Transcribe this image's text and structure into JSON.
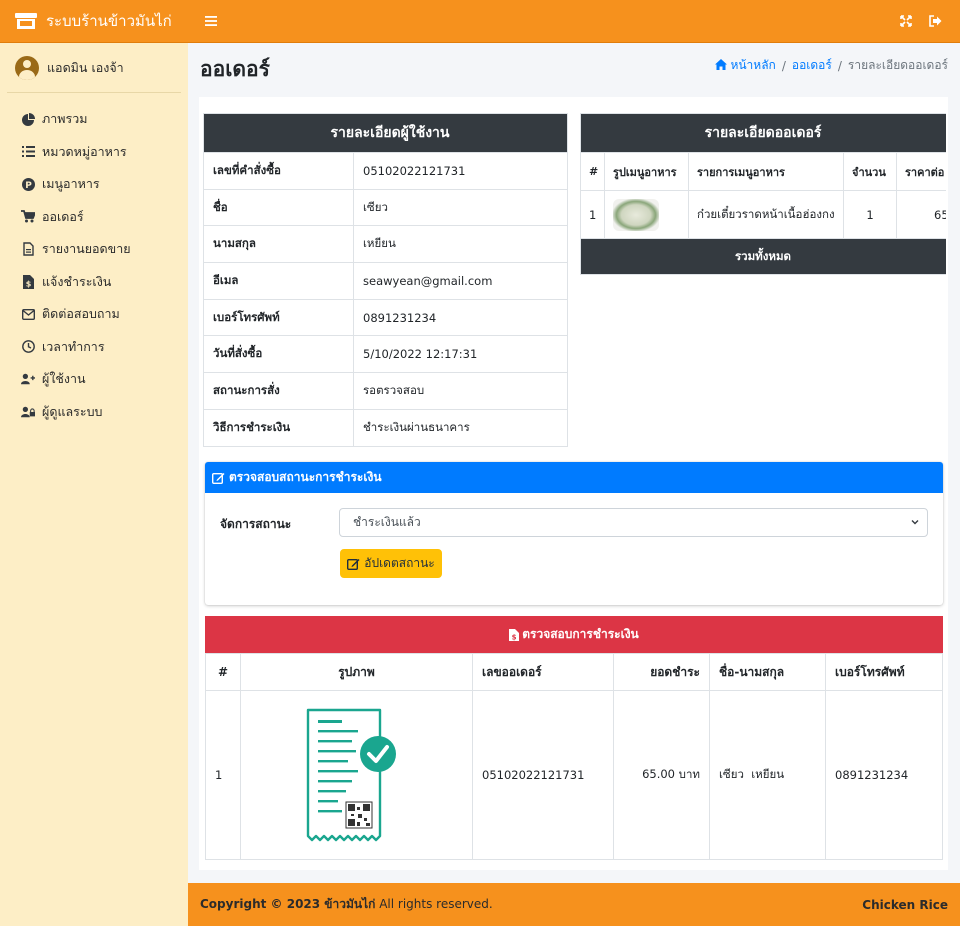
{
  "app": {
    "title": "ระบบร้านข้าวมันไก่"
  },
  "user": {
    "name": "แอดมิน เองจ้า"
  },
  "sidebar": {
    "items": [
      {
        "label": "ภาพรวม",
        "icon": "chart-pie-icon"
      },
      {
        "label": "หมวดหมู่อาหาร",
        "icon": "list-icon"
      },
      {
        "label": "เมนูอาหาร",
        "icon": "product-hunt-icon"
      },
      {
        "label": "ออเดอร์",
        "icon": "cart-icon"
      },
      {
        "label": "รายงานยอดขาย",
        "icon": "file-report-icon"
      },
      {
        "label": "แจ้งชำระเงิน",
        "icon": "file-invoice-dollar-icon"
      },
      {
        "label": "ติดต่อสอบถาม",
        "icon": "envelope-icon"
      },
      {
        "label": "เวลาทำการ",
        "icon": "clock-icon"
      },
      {
        "label": "ผู้ใช้งาน",
        "icon": "user-plus-icon"
      },
      {
        "label": "ผู้ดูแลระบบ",
        "icon": "user-lock-icon"
      }
    ]
  },
  "page": {
    "title": "ออเดอร์"
  },
  "breadcrumb": {
    "home": "หน้าหลัก",
    "orders": "ออเดอร์",
    "current": "รายละเอียดออเดอร์"
  },
  "user_details": {
    "heading": "รายละเอียดผู้ใช้งาน",
    "rows": [
      {
        "k": "เลขที่คำสั่งซื้อ",
        "v": "05102022121731"
      },
      {
        "k": "ชื่อ",
        "v": "เซียว"
      },
      {
        "k": "นามสกุล",
        "v": "เหยียน"
      },
      {
        "k": "อีเมล",
        "v": "seawyean@gmail.com"
      },
      {
        "k": "เบอร์โทรศัพท์",
        "v": "0891231234"
      },
      {
        "k": "วันที่สั่งซื้อ",
        "v": "5/10/2022 12:17:31"
      },
      {
        "k": "สถานะการสั่ง",
        "v": "รอตรวจสอบ"
      },
      {
        "k": "วิธีการชำระเงิน",
        "v": "ชำระเงินผ่านธนาคาร"
      }
    ]
  },
  "order_details": {
    "heading": "รายละเอียดออเดอร์",
    "columns": [
      "#",
      "รูปเมนูอาหาร",
      "รายการเมนูอาหาร",
      "จำนวน",
      "ราคาต่อ"
    ],
    "row": {
      "no": "1",
      "name": "ก๋วยเตี๋ยวราดหน้าเนื้อฮ่องกง",
      "qty": "1",
      "price": "65"
    },
    "total_label": "รวมทั้งหมด"
  },
  "status_card": {
    "title": "ตรวจสอบสถานะการชำระเงิน",
    "label": "จัดการสถานะ",
    "selected": "ชำระเงินแล้ว",
    "button": "อัปเดตสถานะ"
  },
  "payment_card": {
    "title": "ตรวจสอบการชำระเงิน",
    "columns": [
      "#",
      "รูปภาพ",
      "เลขออเดอร์",
      "ยอดชำระ",
      "ชื่อ-นามสกุล",
      "เบอร์โทรศัพท์"
    ],
    "row": {
      "no": "1",
      "order_no": "05102022121731",
      "amount": "65.00 บาท",
      "name": "เซียว  เหยียน",
      "phone": "0891231234"
    }
  },
  "footer": {
    "copyright": "Copyright © 2023 ข้าวมันไก่",
    "rights": " All rights reserved.",
    "right_text": "Chicken Rice"
  },
  "colors": {
    "primary": "#f6911d",
    "sidebar": "#fdeec6",
    "dark": "#343a40",
    "blue": "#007bff",
    "red": "#dc3545",
    "warning": "#ffc107",
    "teal": "#1aa68f"
  }
}
